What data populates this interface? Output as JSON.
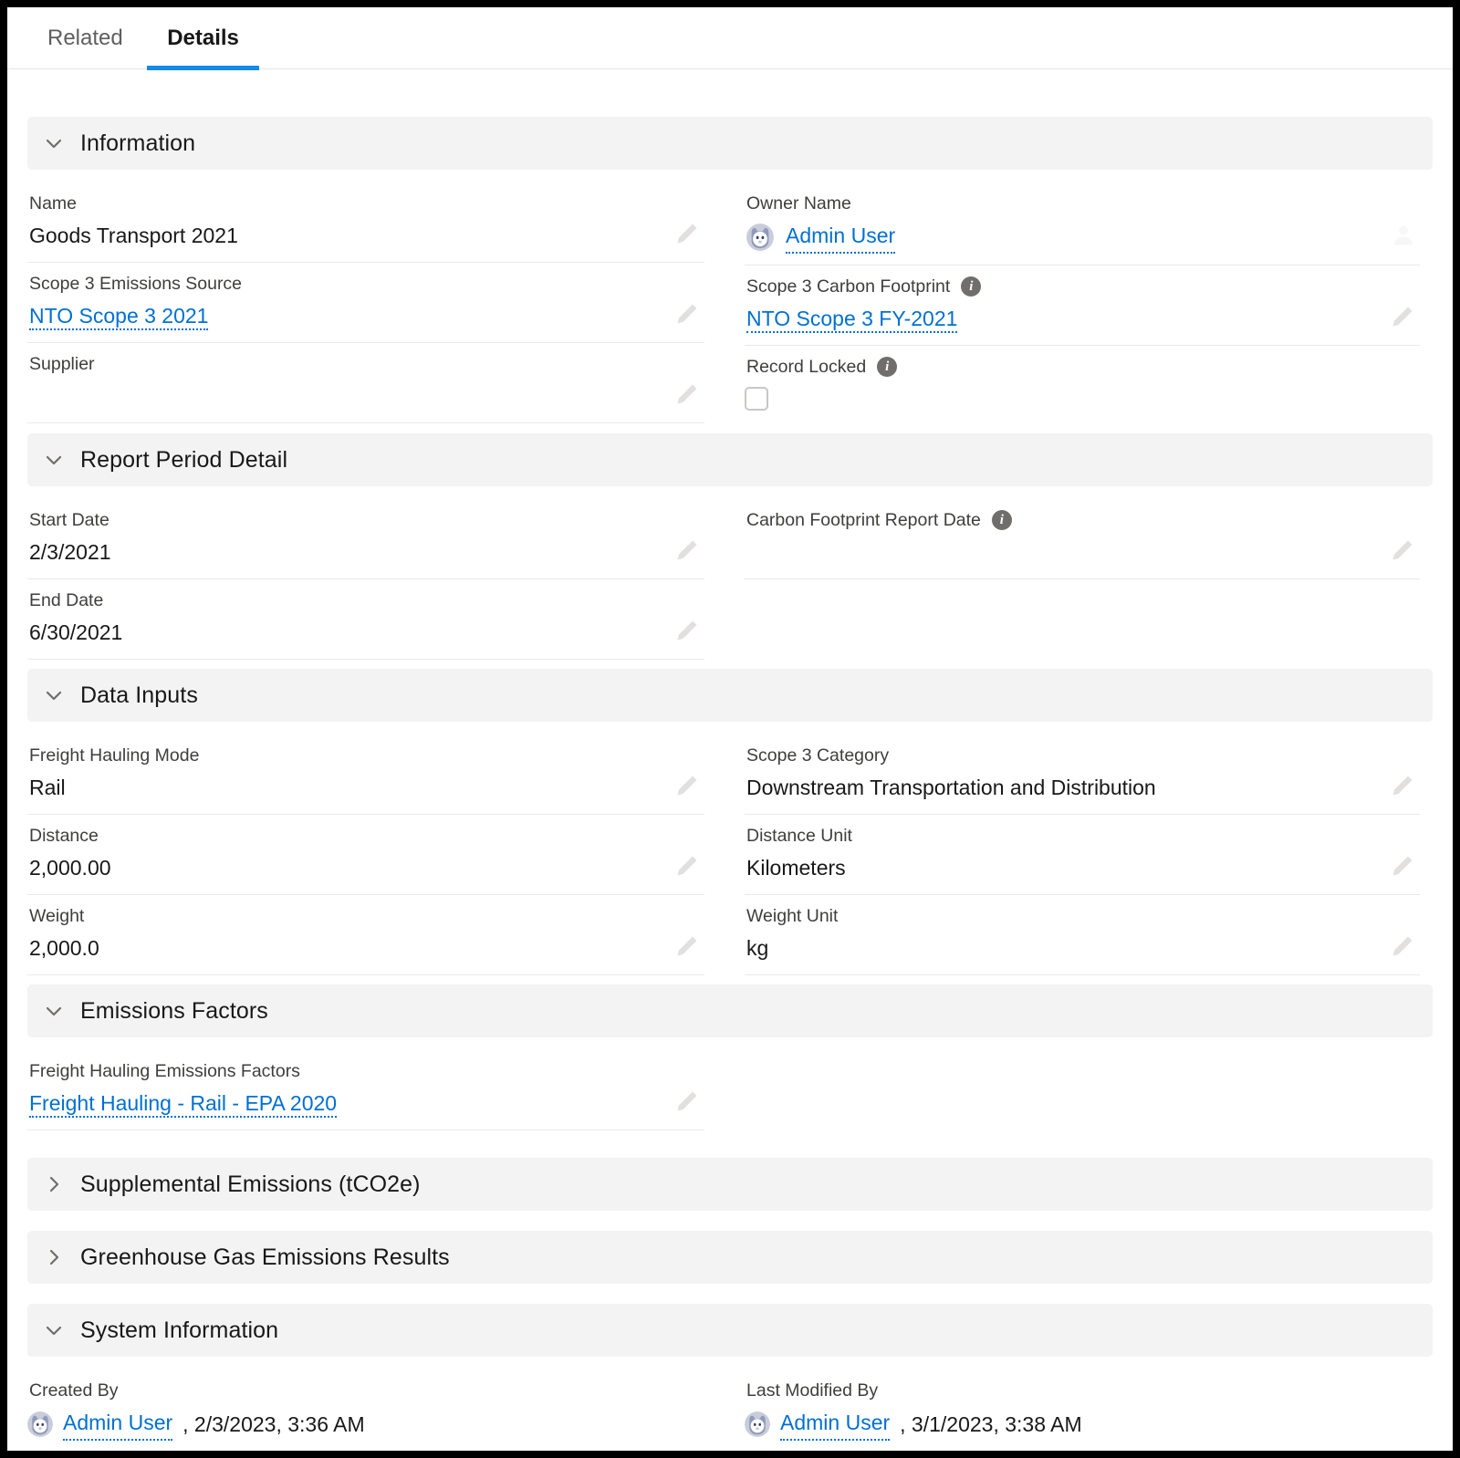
{
  "tabs": [
    {
      "label": "Related",
      "active": false
    },
    {
      "label": "Details",
      "active": true
    }
  ],
  "sections": {
    "information": {
      "title": "Information",
      "expanded": true,
      "chevron": "chevron-down-icon",
      "left": [
        {
          "label": "Name",
          "value": "Goods Transport 2021",
          "type": "text",
          "editable": true
        },
        {
          "label": "Scope 3 Emissions Source",
          "value": "NTO Scope 3 2021",
          "type": "link",
          "editable": true
        },
        {
          "label": "Supplier",
          "value": "",
          "type": "text",
          "editable": true
        }
      ],
      "right": [
        {
          "label": "Owner Name",
          "value": "Admin User",
          "type": "user-link",
          "editable": true,
          "edit_icon": "change-owner-icon"
        },
        {
          "label": "Scope 3 Carbon Footprint",
          "value": "NTO Scope 3 FY-2021",
          "type": "link",
          "editable": true,
          "info": true
        },
        {
          "label": "Record Locked",
          "value": "",
          "type": "checkbox",
          "checked": false,
          "editable": false,
          "info": true
        }
      ]
    },
    "report_period_detail": {
      "title": "Report Period Detail",
      "expanded": true,
      "chevron": "chevron-down-icon",
      "left": [
        {
          "label": "Start Date",
          "value": "2/3/2021",
          "type": "text",
          "editable": true
        },
        {
          "label": "End Date",
          "value": "6/30/2021",
          "type": "text",
          "editable": true
        }
      ],
      "right": [
        {
          "label": "Carbon Footprint Report Date",
          "value": "",
          "type": "text",
          "editable": true,
          "info": true
        }
      ]
    },
    "data_inputs": {
      "title": "Data Inputs",
      "expanded": true,
      "chevron": "chevron-down-icon",
      "left": [
        {
          "label": "Freight Hauling Mode",
          "value": "Rail",
          "type": "text",
          "editable": true
        },
        {
          "label": "Distance",
          "value": "2,000.00",
          "type": "text",
          "editable": true
        },
        {
          "label": "Weight",
          "value": "2,000.0",
          "type": "text",
          "editable": true
        }
      ],
      "right": [
        {
          "label": "Scope 3 Category",
          "value": "Downstream Transportation and Distribution",
          "type": "text",
          "editable": true
        },
        {
          "label": "Distance Unit",
          "value": "Kilometers",
          "type": "text",
          "editable": true
        },
        {
          "label": "Weight Unit",
          "value": "kg",
          "type": "text",
          "editable": true
        }
      ]
    },
    "emissions_factors": {
      "title": "Emissions Factors",
      "expanded": true,
      "chevron": "chevron-down-icon",
      "left": [
        {
          "label": "Freight Hauling Emissions Factors",
          "value": "Freight Hauling - Rail - EPA 2020",
          "type": "link",
          "editable": true
        }
      ],
      "right": []
    },
    "supplemental_emissions": {
      "title": "Supplemental Emissions (tCO2e)",
      "expanded": false,
      "chevron": "chevron-right-icon"
    },
    "ghg_results": {
      "title": "Greenhouse Gas Emissions Results",
      "expanded": false,
      "chevron": "chevron-right-icon"
    },
    "system_information": {
      "title": "System Information",
      "expanded": true,
      "chevron": "chevron-down-icon",
      "created_by": {
        "label": "Created By",
        "user": "Admin User",
        "timestamp": ", 2/3/2023, 3:36 AM"
      },
      "last_modified_by": {
        "label": "Last Modified By",
        "user": "Admin User",
        "timestamp": ", 3/1/2023, 3:38 AM"
      }
    }
  },
  "colors": {
    "link": "#0070d2",
    "tab_active_underline": "#1589ee",
    "section_header_bg": "#f3f3f3",
    "label_text": "#3e3e3c",
    "value_text": "#181818"
  }
}
